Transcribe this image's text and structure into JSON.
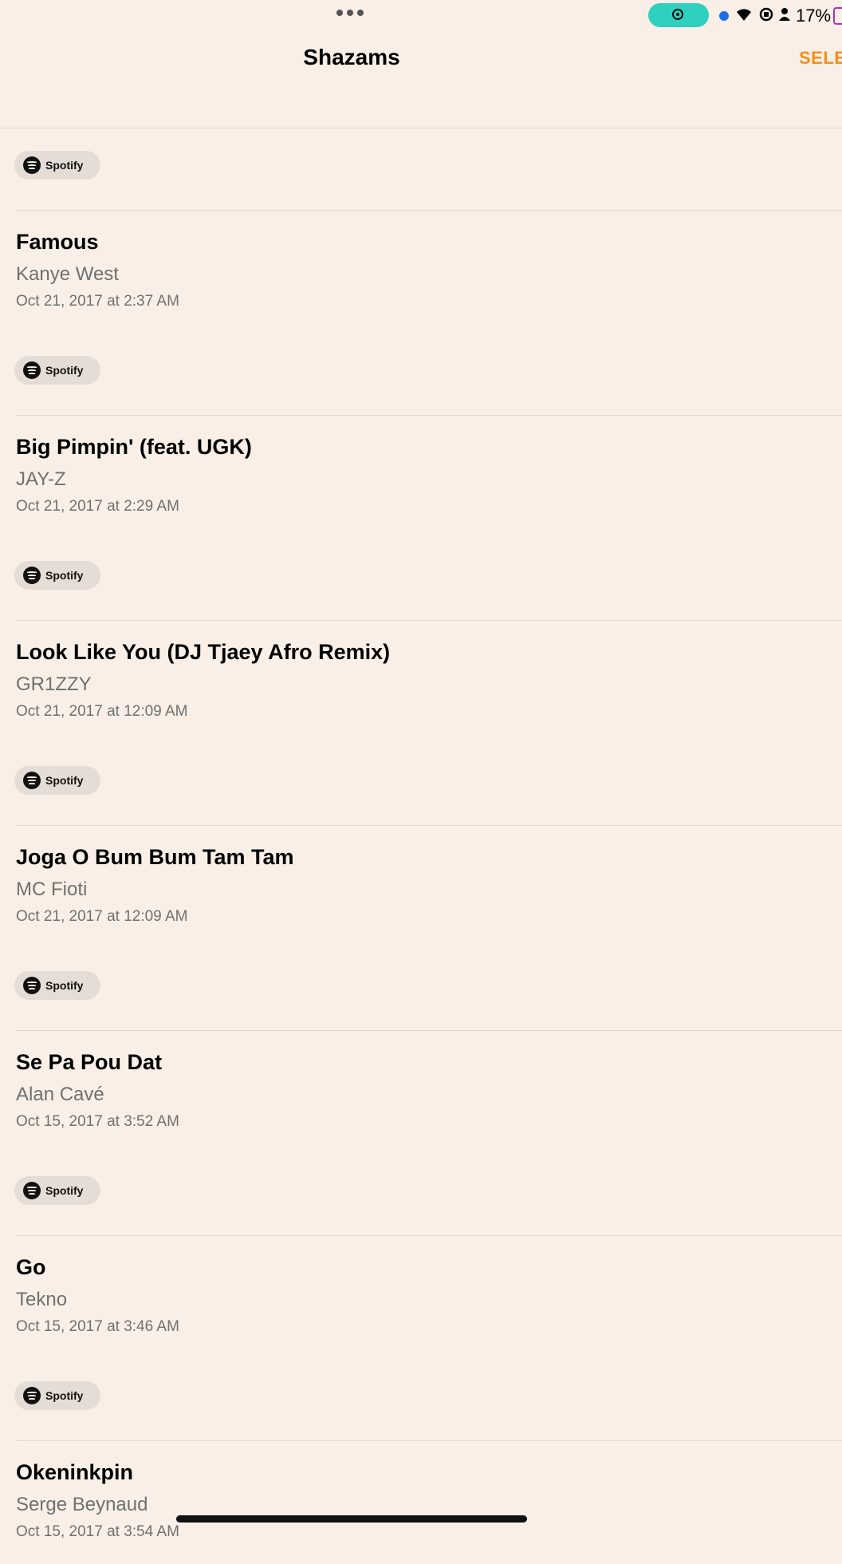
{
  "status_bar": {
    "battery_percent": "17%",
    "icons": [
      "more-dots-icon",
      "screen-record-icon",
      "blue-dot-icon",
      "wifi-icon",
      "rotation-lock-icon",
      "person-icon",
      "battery-icon"
    ],
    "record_pill_color": "#2fd0c0",
    "battery_color": "#c02ab8"
  },
  "header": {
    "title": "Shazams",
    "select_label": "SELE",
    "accent_color": "#f0901e"
  },
  "spotify_label": "Spotify",
  "songs": [
    {
      "title": "Famous",
      "artist": "Kanye West",
      "date": "Oct 21, 2017 at 2:37 AM"
    },
    {
      "title": "Big Pimpin' (feat. UGK)",
      "artist": "JAY-Z",
      "date": "Oct 21, 2017 at 2:29 AM"
    },
    {
      "title": "Look Like You (DJ Tjaey Afro Remix)",
      "artist": "GR1ZZY",
      "date": "Oct 21, 2017 at 12:09 AM"
    },
    {
      "title": "Joga O Bum Bum Tam Tam",
      "artist": "MC Fioti",
      "date": "Oct 21, 2017 at 12:09 AM"
    },
    {
      "title": "Se Pa Pou Dat",
      "artist": "Alan Cavé",
      "date": "Oct 15, 2017 at 3:52 AM"
    },
    {
      "title": "Go",
      "artist": "Tekno",
      "date": "Oct 15, 2017 at 3:46 AM"
    },
    {
      "title": "Okeninkpin",
      "artist": "Serge Beynaud",
      "date": "Oct 15, 2017 at 3:54 AM"
    }
  ]
}
